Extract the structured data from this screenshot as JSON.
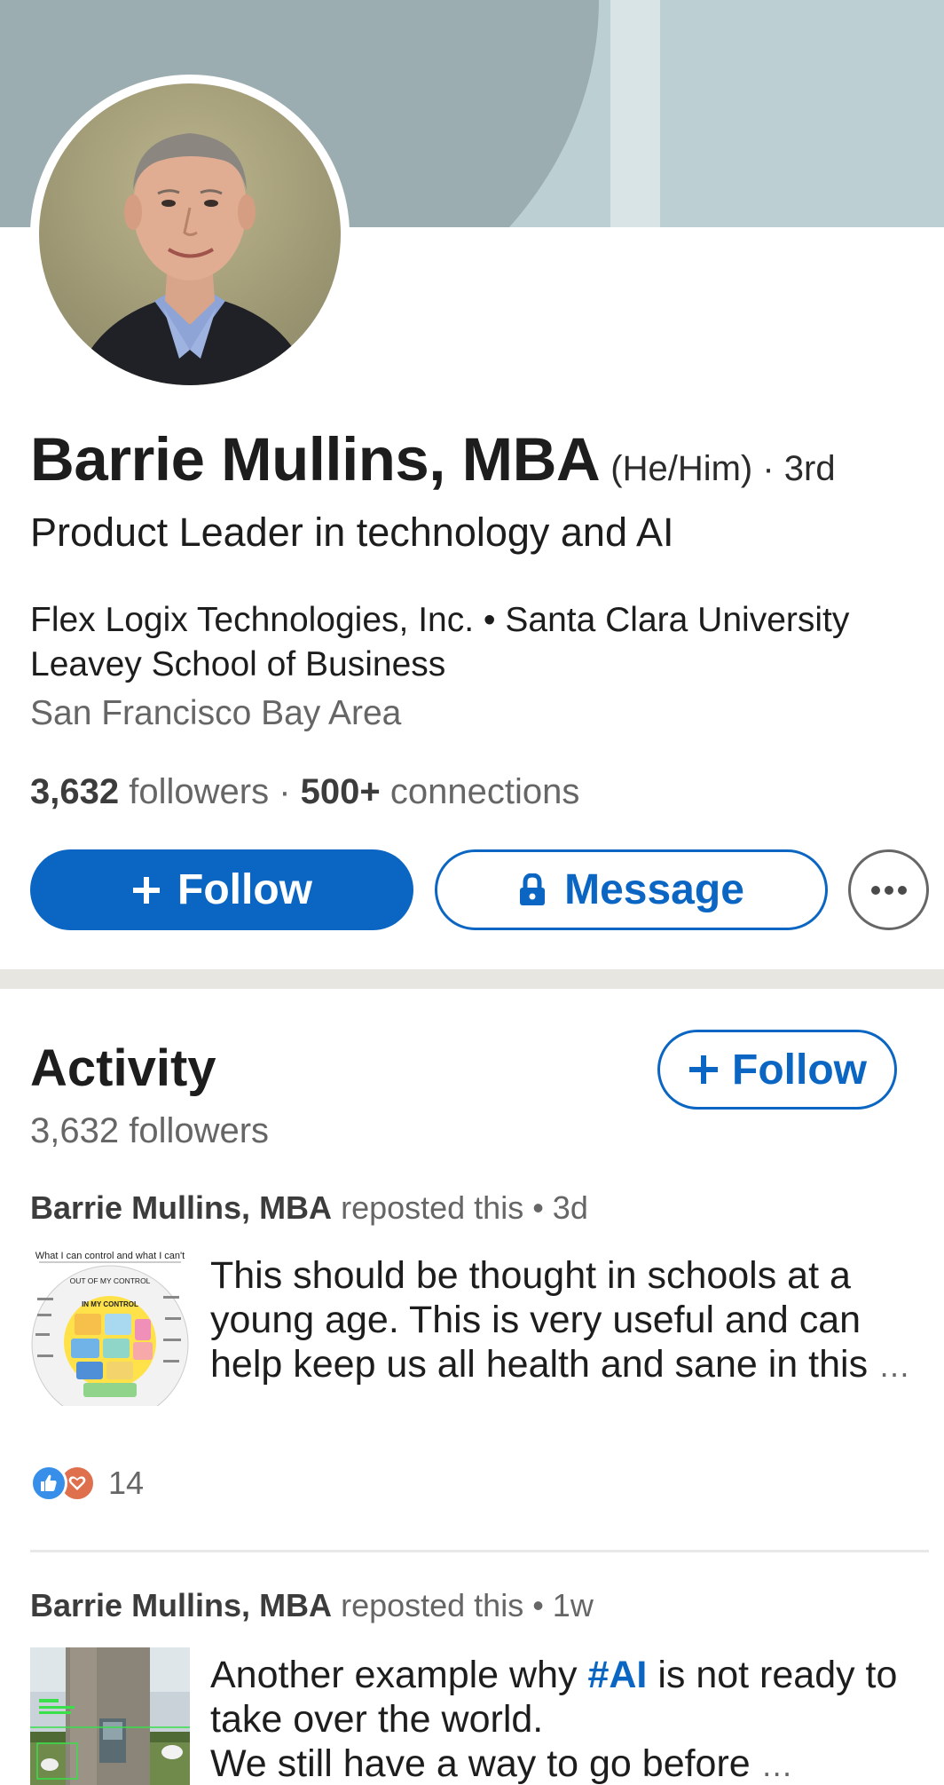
{
  "profile": {
    "name": "Barrie Mullins, MBA",
    "pronouns_degree": "(He/Him) · 3rd",
    "headline": "Product Leader in technology and AI",
    "company_school": "Flex Logix Technologies, Inc. • Santa Clara University Leavey School of Business",
    "location": "San Francisco Bay Area",
    "followers_count": "3,632",
    "followers_label": "followers",
    "stats_separator": "·",
    "connections_count": "500+",
    "connections_label": "connections"
  },
  "actions": {
    "follow_label": "Follow",
    "message_label": "Message"
  },
  "activity": {
    "title": "Activity",
    "followers_text": "3,632 followers",
    "follow_label": "Follow",
    "posts": [
      {
        "author": "Barrie Mullins, MBA",
        "meta": "reposted this • 3d",
        "text": "This should be thought in schools at a young age. This is very useful and can help keep us all health and sane in this",
        "more": "…",
        "reaction_count": "14",
        "thumbnail": {
          "title": "What I can control and what I can't",
          "outer_label": "OUT OF MY CONTROL",
          "inner_label": "IN MY CONTROL"
        }
      },
      {
        "author": "Barrie Mullins, MBA",
        "meta": "reposted this • 1w",
        "text_before": "Another example why ",
        "hashtag": "#AI",
        "text_after": " is not ready to take over the world.",
        "text_line3": "We still have a way to go before",
        "more": "…"
      }
    ]
  },
  "colors": {
    "brand_blue": "#0a66c2",
    "banner": "#bccfd2",
    "like_blue": "#378fe9",
    "love_orange": "#df704d"
  },
  "icons": [
    "plus-icon",
    "lock-icon",
    "more-options-icon",
    "like-reaction-icon",
    "love-reaction-icon"
  ]
}
